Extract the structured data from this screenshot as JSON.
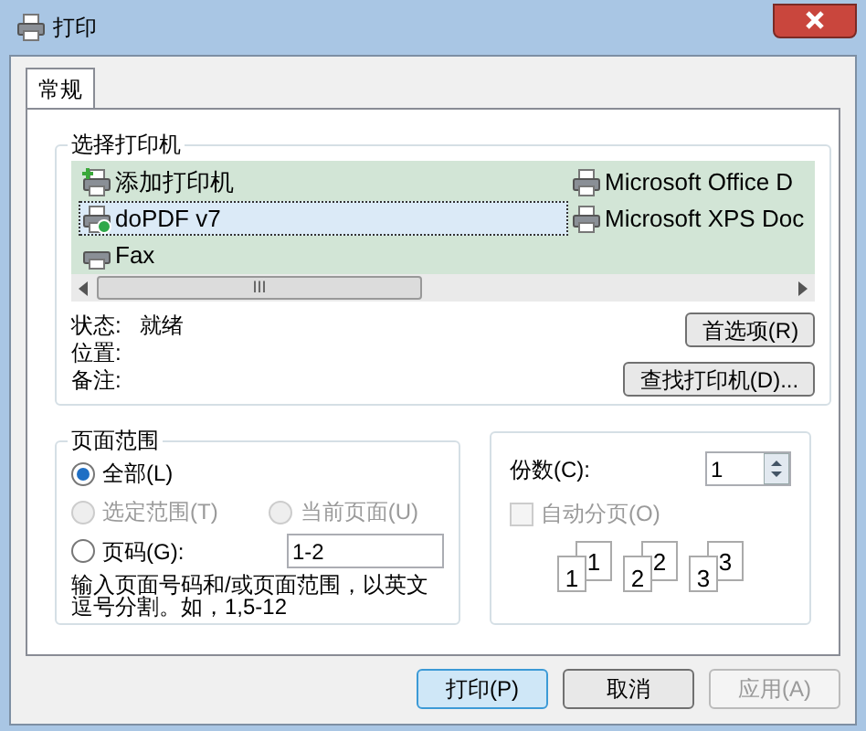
{
  "window": {
    "title": "打印"
  },
  "tabs": [
    {
      "label": "常规",
      "selected": true
    }
  ],
  "printer_group": {
    "title": "选择打印机",
    "printers": [
      {
        "name": "添加打印机",
        "kind": "add",
        "selected": false
      },
      {
        "name": "doPDF v7",
        "kind": "default",
        "selected": true
      },
      {
        "name": "Fax",
        "kind": "fax",
        "selected": false
      },
      {
        "name": "Microsoft Office D",
        "kind": "printer",
        "selected": false
      },
      {
        "name": "Microsoft XPS Doc",
        "kind": "printer",
        "selected": false
      }
    ],
    "scroll_grip": "III",
    "info": [
      {
        "label": "状态:",
        "value": "就绪"
      },
      {
        "label": "位置:"
      },
      {
        "label": "备注:"
      }
    ],
    "preferences_button": "首选项(R)",
    "find_button": "查找打印机(D)..."
  },
  "page_range": {
    "title": "页面范围",
    "options": [
      {
        "label": "全部(L)",
        "selected": true,
        "disabled": false
      },
      {
        "label": "选定范围(T)",
        "selected": false,
        "disabled": true
      },
      {
        "label": "当前页面(U)",
        "selected": false,
        "disabled": true
      },
      {
        "label": "页码(G):",
        "selected": false,
        "disabled": false
      }
    ],
    "pages_value": "1-2",
    "hint": "输入页面号码和/或页面范围，以英文逗号分割。如，1,5-12"
  },
  "copies": {
    "label": "份数(C):",
    "value": "1",
    "collate": {
      "label": "自动分页(O)",
      "checked": false,
      "disabled": true
    },
    "collate_stacks": [
      {
        "back": "1",
        "front": "1"
      },
      {
        "back": "2",
        "front": "2"
      },
      {
        "back": "3",
        "front": "3"
      }
    ]
  },
  "buttons": [
    {
      "label": "打印(P)",
      "kind": "default",
      "disabled": false
    },
    {
      "label": "取消",
      "kind": "normal",
      "disabled": false
    },
    {
      "label": "应用(A)",
      "kind": "normal",
      "disabled": true
    }
  ]
}
